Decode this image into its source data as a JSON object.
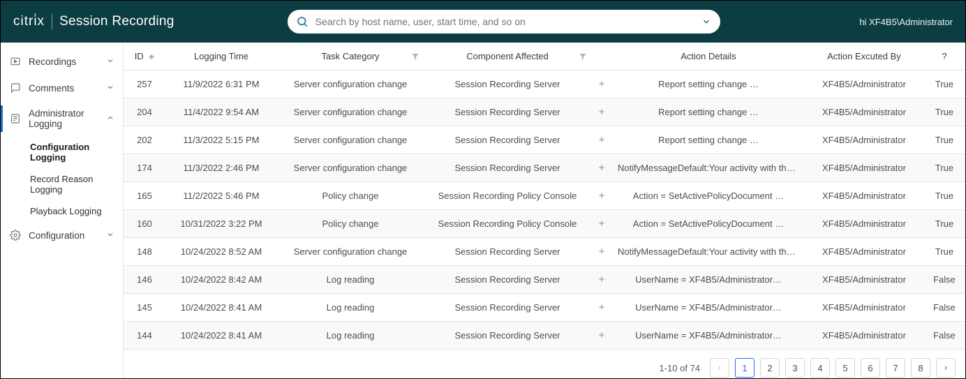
{
  "header": {
    "brand_logo": "citri̇x",
    "brand_product": "Session Recording",
    "search_placeholder": "Search by host name, user, start time, and so on",
    "user_label": "hi XF4B5\\Administrator"
  },
  "sidebar": {
    "items": [
      {
        "label": "Recordings",
        "icon": "play-icon",
        "expandable": true,
        "expanded": false
      },
      {
        "label": "Comments",
        "icon": "comment-icon",
        "expandable": true,
        "expanded": false
      },
      {
        "label": "Administrator Logging",
        "icon": "log-icon",
        "expandable": true,
        "expanded": true,
        "children": [
          {
            "label": "Configuration Logging",
            "active": true
          },
          {
            "label": "Record Reason Logging",
            "active": false
          },
          {
            "label": "Playback Logging",
            "active": false
          }
        ]
      },
      {
        "label": "Configuration",
        "icon": "gear-icon",
        "expandable": true,
        "expanded": false
      }
    ]
  },
  "table": {
    "columns": [
      "ID",
      "Logging Time",
      "Task Category",
      "Component Affected",
      "",
      "Action Details",
      "Action Excuted By",
      "?"
    ],
    "rows": [
      {
        "id": "257",
        "time": "11/9/2022 6:31 PM",
        "category": "Server configuration change",
        "component": "Session Recording Server",
        "details": "Report setting change …",
        "by": "XF4B5/Administrator",
        "q": "True"
      },
      {
        "id": "204",
        "time": "11/4/2022 9:54 AM",
        "category": "Server configuration change",
        "component": "Session Recording Server",
        "details": "Report setting change …",
        "by": "XF4B5/Administrator",
        "q": "True"
      },
      {
        "id": "202",
        "time": "11/3/2022 5:15 PM",
        "category": "Server configuration change",
        "component": "Session Recording Server",
        "details": "Report setting change …",
        "by": "XF4B5/Administrator",
        "q": "True"
      },
      {
        "id": "174",
        "time": "11/3/2022 2:46 PM",
        "category": "Server configuration change",
        "component": "Session Recording Server",
        "details": "NotifyMessageDefault:Your activity with the desktop or p…",
        "by": "XF4B5/Administrator",
        "q": "True"
      },
      {
        "id": "165",
        "time": "11/2/2022 5:46 PM",
        "category": "Policy change",
        "component": "Session Recording Policy Console",
        "details": "Action = SetActivePolicyDocument …",
        "by": "XF4B5/Administrator",
        "q": "True"
      },
      {
        "id": "160",
        "time": "10/31/2022 3:22 PM",
        "category": "Policy change",
        "component": "Session Recording Policy Console",
        "details": "Action = SetActivePolicyDocument …",
        "by": "XF4B5/Administrator",
        "q": "True"
      },
      {
        "id": "148",
        "time": "10/24/2022 8:52 AM",
        "category": "Server configuration change",
        "component": "Session Recording Server",
        "details": "NotifyMessageDefault:Your activity with the desktop or p…",
        "by": "XF4B5/Administrator",
        "q": "True"
      },
      {
        "id": "146",
        "time": "10/24/2022 8:42 AM",
        "category": "Log reading",
        "component": "Session Recording Server",
        "details": "UserName = XF4B5/Administrator…",
        "by": "XF4B5/Administrator",
        "q": "False"
      },
      {
        "id": "145",
        "time": "10/24/2022 8:41 AM",
        "category": "Log reading",
        "component": "Session Recording Server",
        "details": "UserName = XF4B5/Administrator…",
        "by": "XF4B5/Administrator",
        "q": "False"
      },
      {
        "id": "144",
        "time": "10/24/2022 8:41 AM",
        "category": "Log reading",
        "component": "Session Recording Server",
        "details": "UserName = XF4B5/Administrator…",
        "by": "XF4B5/Administrator",
        "q": "False"
      }
    ]
  },
  "pager": {
    "range": "1-10 of 74",
    "pages": [
      "1",
      "2",
      "3",
      "4",
      "5",
      "6",
      "7",
      "8"
    ],
    "current": "1"
  }
}
